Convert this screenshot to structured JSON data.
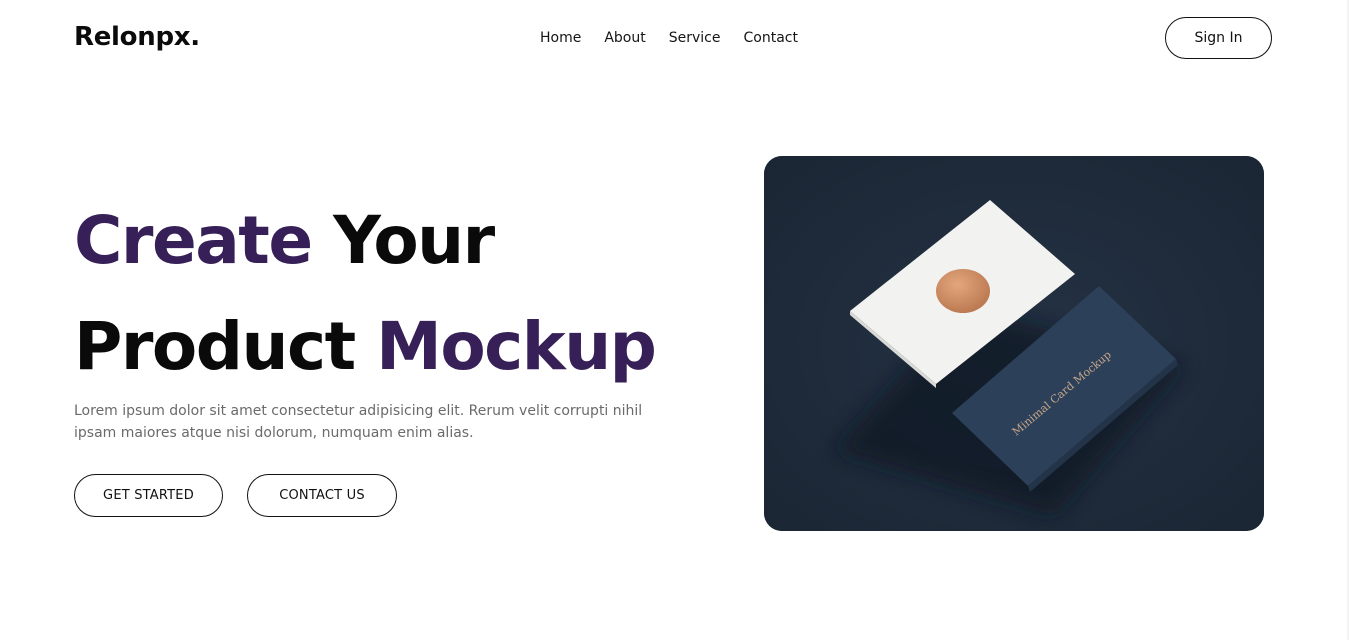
{
  "header": {
    "logo": "Relonpx.",
    "nav": [
      "Home",
      "About",
      "Service",
      "Contact"
    ],
    "signin_label": "Sign In"
  },
  "hero": {
    "headline": {
      "word1": "Create",
      "word2": "Your",
      "word3": "Product",
      "word4": "Mockup"
    },
    "description": "Lorem ipsum dolor sit amet consectetur adipisicing elit. Rerum velit corrupti nihil ipsam maiores atque nisi dolorum, numquam enim alias.",
    "buttons": {
      "get_started": "GET STARTED",
      "contact_us": "CONTACT US"
    },
    "image": {
      "card_text": "Minimal Card Mockup"
    }
  },
  "colors": {
    "accent": "#372057",
    "image_bg": "#1f2a38",
    "text": "#0a0a0a",
    "muted": "#6a6a6a"
  }
}
